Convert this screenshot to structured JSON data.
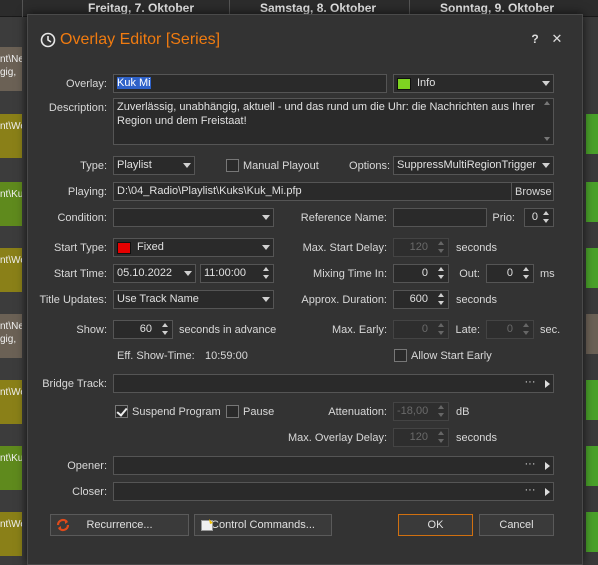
{
  "background": {
    "days": [
      "Freitag, 7. Oktober",
      "Samstag, 8. Oktober",
      "Sonntag, 9. Oktober"
    ],
    "left_blocks": [
      {
        "text": "nt\\New\\ngig,",
        "color": "#6b6155"
      },
      {
        "text": "nt\\Wet",
        "color": "#8a8018"
      },
      {
        "text": "nt\\Kuk",
        "color": "#5f8a1d"
      },
      {
        "text": "nt\\Wet",
        "color": "#8a8018"
      },
      {
        "text": "nt\\New\\ngig,",
        "color": "#6b6155"
      },
      {
        "text": "nt\\Wet",
        "color": "#8a8018"
      },
      {
        "text": "nt\\Kuk",
        "color": "#5f8a1d"
      },
      {
        "text": "nt\\Wet",
        "color": "#8a8018"
      }
    ]
  },
  "dialog": {
    "title": "Overlay Editor [Series]",
    "help": "?",
    "close": "✕",
    "accent_color": "#f07b10"
  },
  "form": {
    "overlay_label": "Overlay:",
    "overlay_value": "Kuk Mi",
    "category_value": "Info",
    "category_color": "#7ed321",
    "description_label": "Description:",
    "description_value": "Zuverlässig, unabhängig, aktuell - und das rund um die Uhr: die Nachrichten aus Ihrer Region und dem Freistaat!",
    "type_label": "Type:",
    "type_value": "Playlist",
    "manual_playout_label": "Manual Playout",
    "manual_playout_checked": false,
    "options_label": "Options:",
    "options_value": "SuppressMultiRegionTrigger",
    "playing_label": "Playing:",
    "playing_value": "D:\\04_Radio\\Playlist\\Kuks\\Kuk_Mi.pfp",
    "browse_label": "Browse",
    "condition_label": "Condition:",
    "condition_value": "",
    "reference_name_label": "Reference Name:",
    "reference_name_value": "",
    "prio_label": "Prio:",
    "prio_value": "0",
    "start_type_label": "Start Type:",
    "start_type_value": "Fixed",
    "start_type_color": "#e60000",
    "max_start_delay_label": "Max. Start Delay:",
    "max_start_delay_value": "120",
    "seconds_label": "seconds",
    "start_time_label": "Start Time:",
    "start_date_value": "05.10.2022",
    "start_time_value": "11:00:00",
    "mixing_time_in_label": "Mixing Time In:",
    "mixing_time_in_value": "0",
    "out_label": "Out:",
    "out_value": "0",
    "ms_label": "ms",
    "title_updates_label": "Title Updates:",
    "title_updates_value": "Use Track Name",
    "approx_duration_label": "Approx. Duration:",
    "approx_duration_value": "600",
    "show_label": "Show:",
    "show_value": "60",
    "seconds_in_advance_label": "seconds in advance",
    "max_early_label": "Max. Early:",
    "max_early_value": "0",
    "late_label": "Late:",
    "late_value": "0",
    "sec_label": "sec.",
    "eff_show_time_label": "Eff. Show-Time:",
    "eff_show_time_value": "10:59:00",
    "allow_start_early_label": "Allow Start Early",
    "allow_start_early_checked": false,
    "bridge_track_label": "Bridge Track:",
    "bridge_track_value": "",
    "suspend_program_label": "Suspend Program",
    "suspend_program_checked": true,
    "pause_label": "Pause",
    "pause_checked": false,
    "attenuation_label": "Attenuation:",
    "attenuation_value": "-18,00",
    "db_label": "dB",
    "max_overlay_delay_label": "Max. Overlay Delay:",
    "max_overlay_delay_value": "120",
    "opener_label": "Opener:",
    "opener_value": "",
    "closer_label": "Closer:",
    "closer_value": "",
    "ellipsis": "···"
  },
  "buttons": {
    "recurrence": "Recurrence...",
    "control_commands": "Control Commands...",
    "ok": "OK",
    "cancel": "Cancel"
  }
}
